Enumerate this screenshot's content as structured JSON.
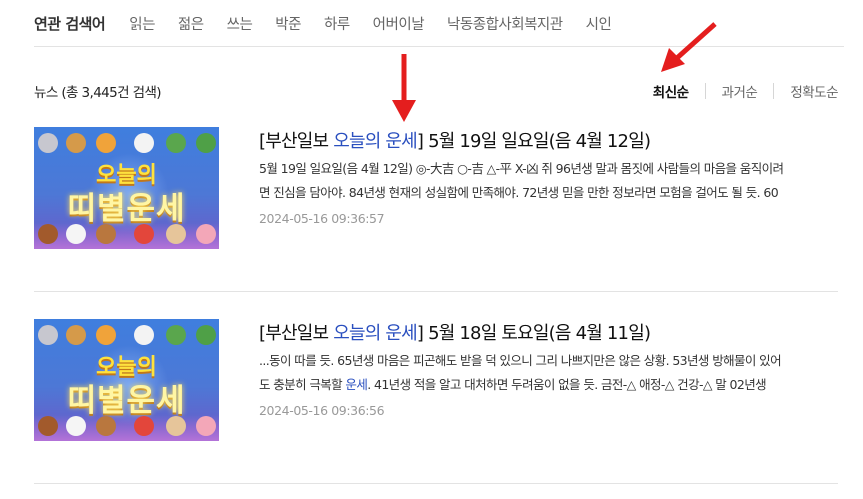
{
  "related": {
    "label": "연관 검색어",
    "keywords": [
      "읽는",
      "젊은",
      "쓰는",
      "박준",
      "하루",
      "어버이날",
      "낙동종합사회복지관",
      "시인"
    ]
  },
  "results": {
    "count_text": "뉴스 (총 3,445건 검색)"
  },
  "sort": {
    "options": [
      "최신순",
      "과거순",
      "정확도순"
    ],
    "active": "최신순"
  },
  "news": [
    {
      "title_prefix": "[부산일보 ",
      "title_highlight": "오늘의 운세",
      "title_suffix": "] 5월 19일 일요일(음 4월 12일)",
      "snippet_line1": "5월 19일 일요일(음 4월 12일) ◎-大吉 ○-吉 △-平 X-凶 쥐 96년생 말과 몸짓에 사람들의 마음을 움직이려",
      "snippet_line2": "면 진심을 담아야. 84년생 현재의 성실함에 만족해야. 72년생 믿을 만한 정보라면 모험을 걸어도 될 듯. 60",
      "date": "2024-05-16 09:36:57",
      "thumb_line1": "오늘의",
      "thumb_line2": "띠별운세"
    },
    {
      "title_prefix": "[부산일보 ",
      "title_highlight": "오늘의 운세",
      "title_suffix": "] 5월 18일 토요일(음 4월 11일)",
      "snippet_line1": "...동이 따를 듯. 65년생 마음은 피곤해도 받을 덕 있으니 그리 나쁘지만은 않은 상황. 53년생 방해물이 있어",
      "snippet_line2a": "도 충분히 극복할 ",
      "snippet_line2_hl": "운세",
      "snippet_line2b": ". 41년생 적을 알고 대처하면 두려움이 없을 듯. 금전-△ 애정-△ 건강-△ 말 02년생",
      "date": "2024-05-16 09:36:56",
      "thumb_line1": "오늘의",
      "thumb_line2": "띠별운세"
    }
  ],
  "colors": {
    "highlight": "#2a4fbf",
    "arrow": "#e41e1e"
  }
}
